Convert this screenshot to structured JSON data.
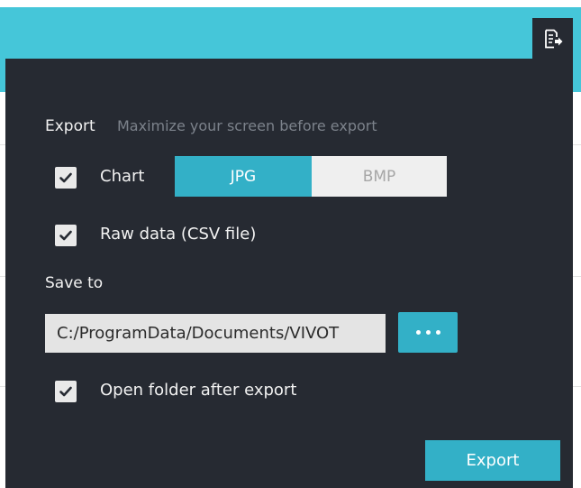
{
  "header": {
    "accent_color": "#45c6d9",
    "export_toggle_icon": "export-icon"
  },
  "export_panel": {
    "background_color": "#262a32",
    "export_section": {
      "title": "Export",
      "hint": "Maximize your screen before export"
    },
    "chart_option": {
      "label": "Chart",
      "checked": true,
      "formats": [
        {
          "label": "JPG",
          "selected": true
        },
        {
          "label": "BMP",
          "selected": false
        }
      ]
    },
    "raw_data_option": {
      "label": "Raw data (CSV file)",
      "checked": true
    },
    "save_to": {
      "title": "Save to",
      "path_value": "C:/ProgramData/Documents/VIVOT",
      "browse_icon": "more-dots-icon"
    },
    "open_folder_option": {
      "label": "Open folder after export",
      "checked": true
    },
    "export_button_label": "Export"
  }
}
